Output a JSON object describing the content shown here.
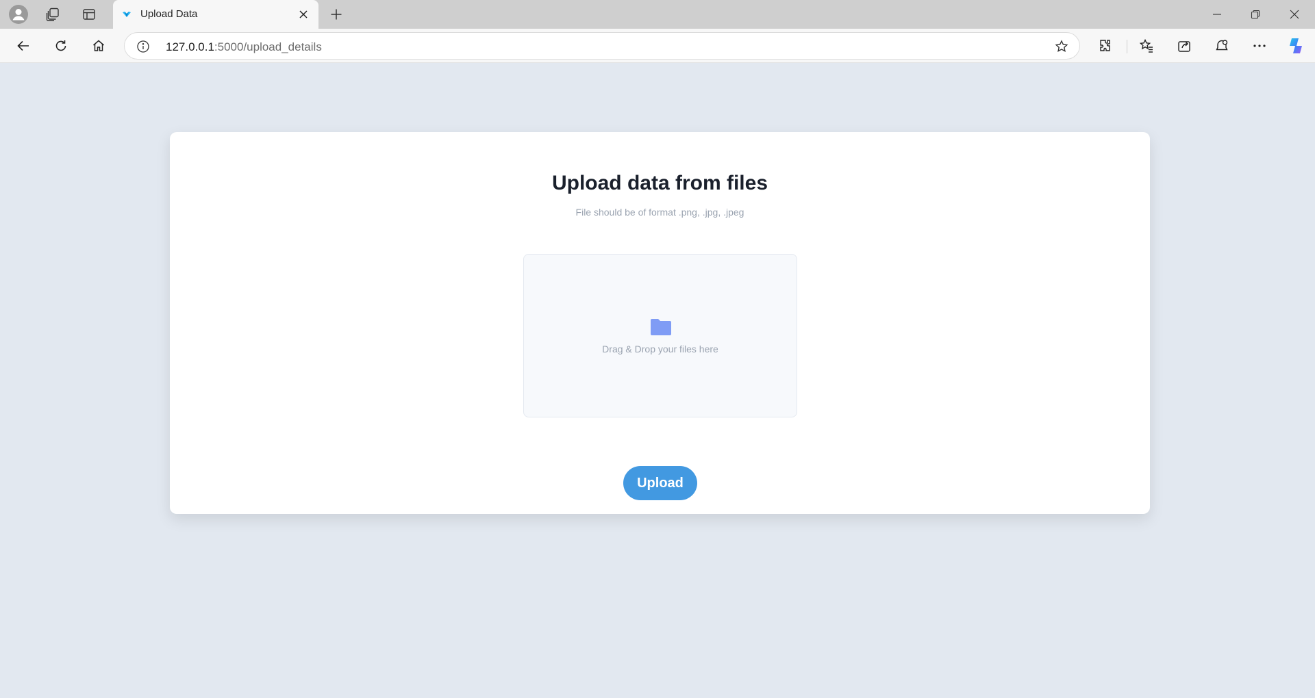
{
  "browser": {
    "tab": {
      "title": "Upload Data"
    },
    "address": {
      "host": "127.0.0.1",
      "rest": ":5000/upload_details"
    },
    "icons": [
      "profile-icon",
      "workspaces-icon",
      "vertical-tabs-icon",
      "close-icon",
      "new-tab-icon",
      "minimize-icon",
      "restore-icon",
      "window-close-icon",
      "back-icon",
      "refresh-icon",
      "home-icon",
      "site-info-icon",
      "favorite-star-icon",
      "extensions-icon",
      "favorites-icon",
      "share-icon",
      "browser-essentials-icon",
      "more-icon",
      "copilot-icon"
    ]
  },
  "page": {
    "title": "Upload data from files",
    "subtitle": "File should be of format .png, .jpg, .jpeg",
    "dropzone_text": "Drag & Drop your files here",
    "upload_label": "Upload"
  },
  "colors": {
    "page_bg": "#e2e8f0",
    "accent": "#4299e1",
    "folder": "#7f9cf5"
  }
}
